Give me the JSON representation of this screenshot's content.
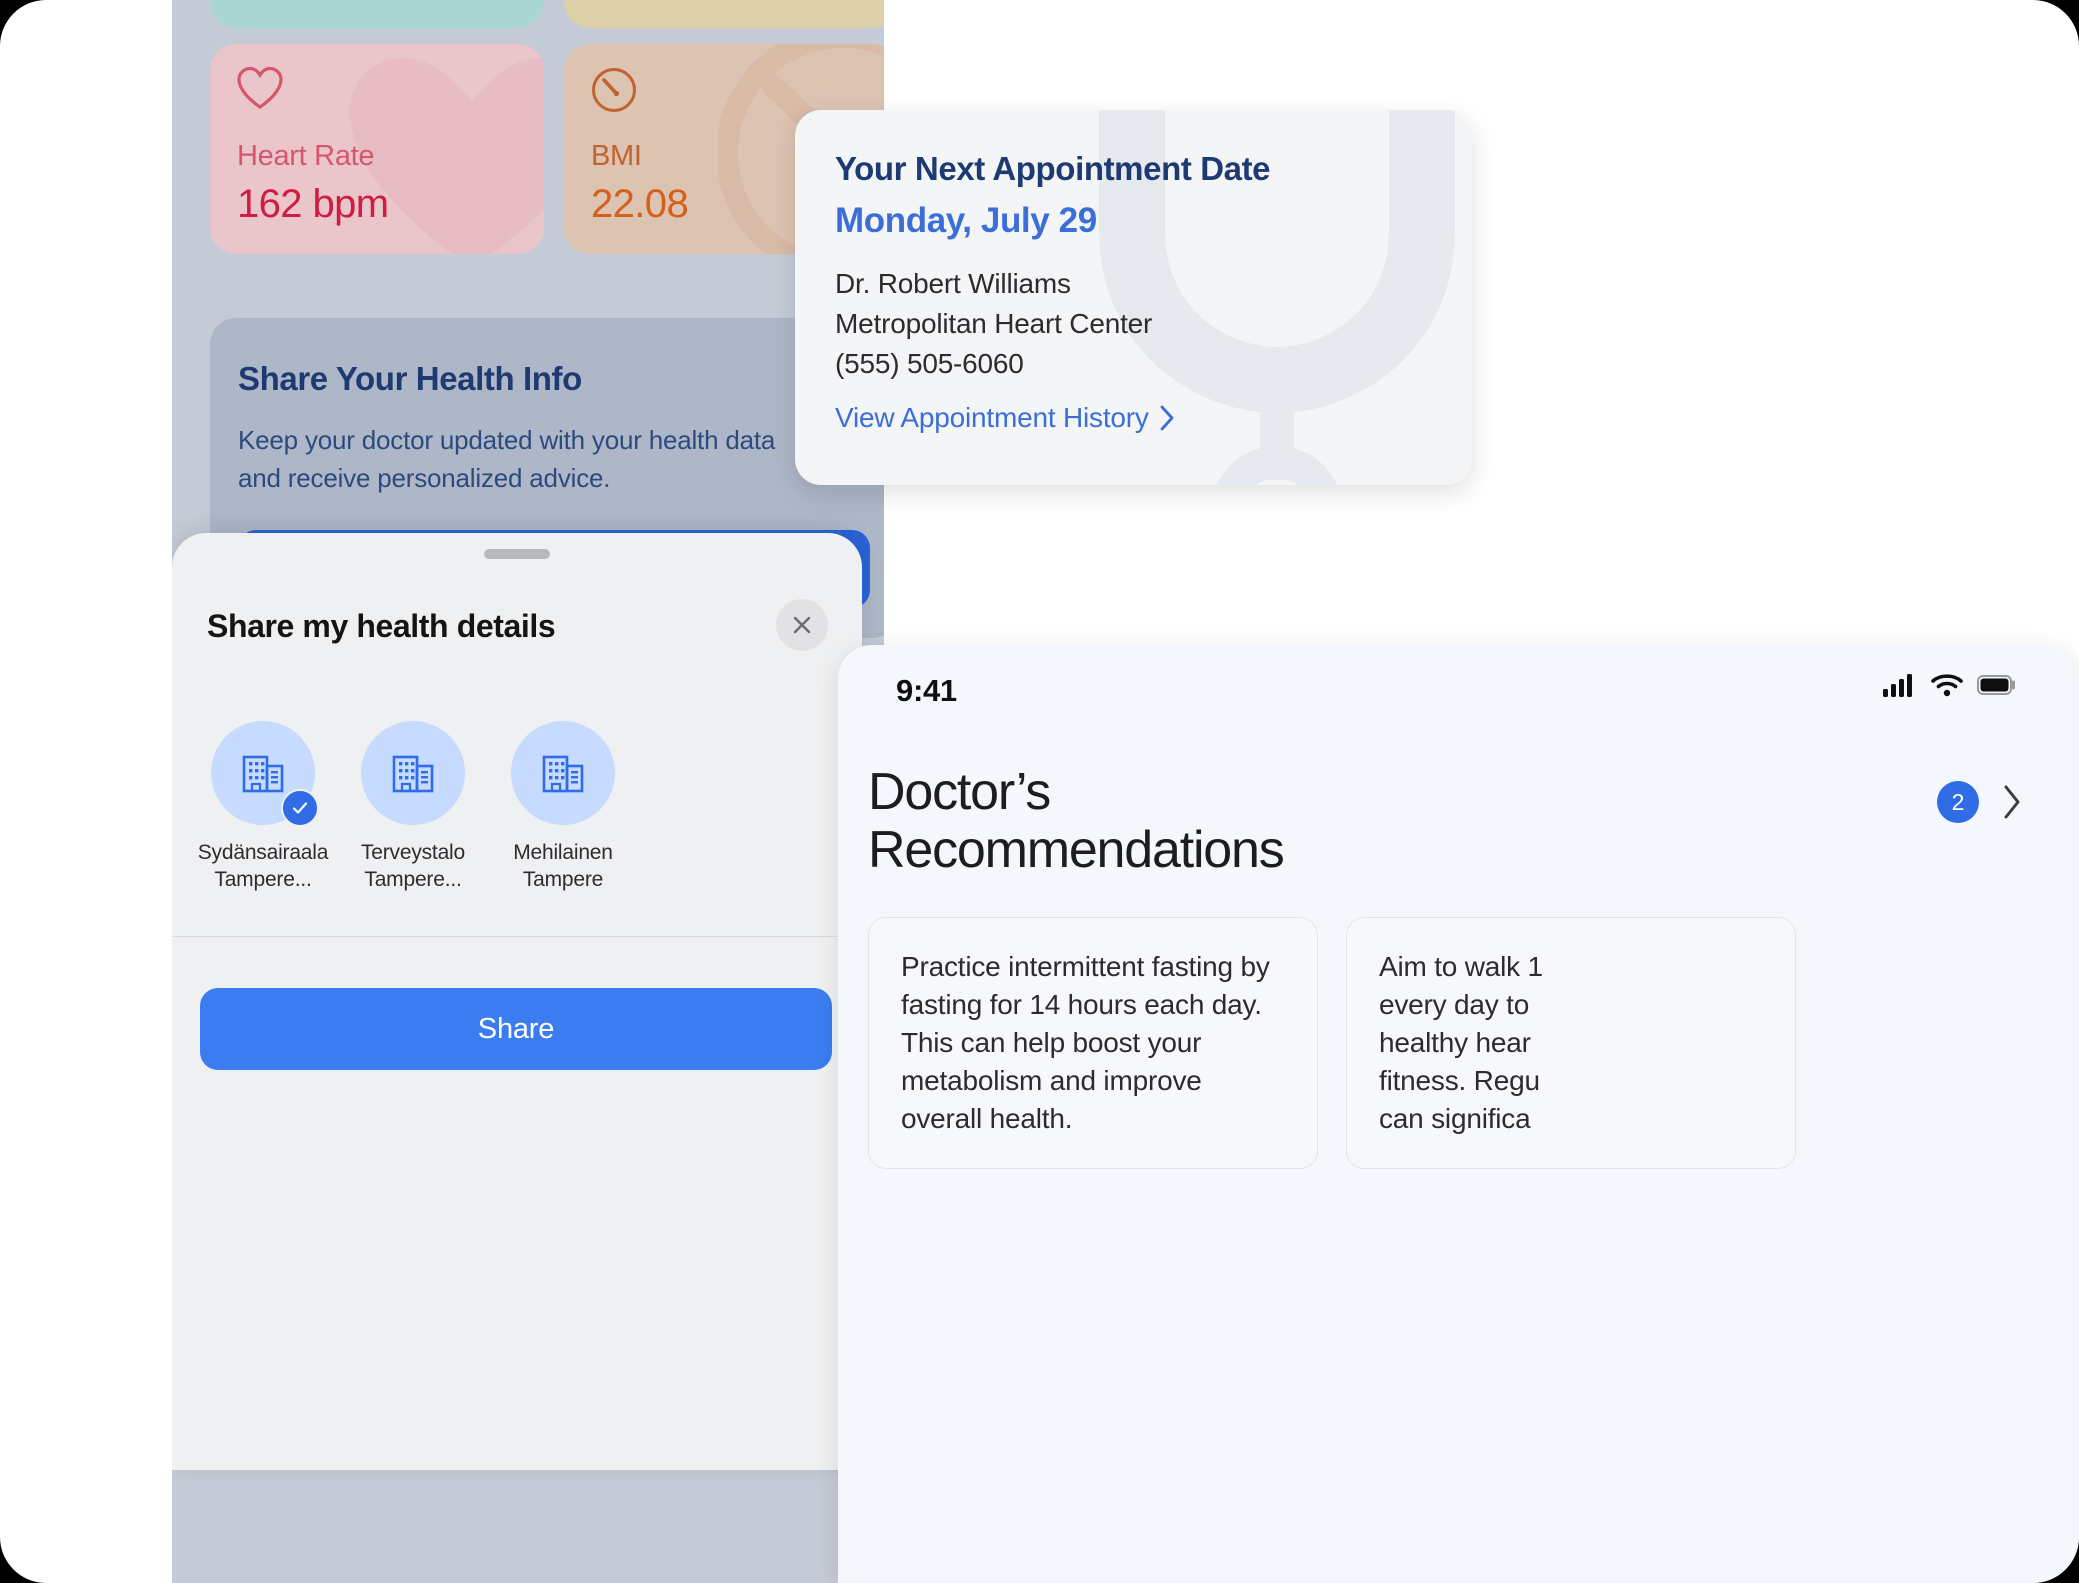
{
  "left_screen": {
    "metrics": [
      {
        "icon": "heart-icon",
        "label": "Heart Rate",
        "value": "162 bpm"
      },
      {
        "icon": "gauge-icon",
        "label": "BMI",
        "value": "22.08"
      }
    ],
    "share_info": {
      "title": "Share Your Health Info",
      "description": "Keep your doctor updated with your health data and receive personalized advice."
    }
  },
  "share_sheet": {
    "title": "Share my health details",
    "close_icon": "close-icon",
    "providers": [
      {
        "name": "Sydänsairaala\nTampere...",
        "icon": "hospital-building-icon",
        "selected": true
      },
      {
        "name": "Terveystalo\nTampere...",
        "icon": "hospital-building-icon",
        "selected": false
      },
      {
        "name": "Mehilainen\nTampere",
        "icon": "hospital-building-icon",
        "selected": false
      }
    ],
    "submit_label": "Share"
  },
  "appointment_card": {
    "heading": "Your Next Appointment Date",
    "date": "Monday, July 29",
    "doctor": "Dr. Robert Williams",
    "clinic": "Metropolitan Heart Center",
    "phone": "(555) 505-6060",
    "history_link": "View Appointment History",
    "history_chevron": "chevron-right-icon",
    "watermark_icon": "stethoscope-icon"
  },
  "recommendations_phone": {
    "status_bar": {
      "time": "9:41",
      "icons": [
        "cellular-signal-icon",
        "wifi-icon",
        "battery-icon"
      ]
    },
    "title": "Doctor’s Recommendations",
    "badge_count": "2",
    "chevron_icon": "chevron-right-icon",
    "cards": [
      "Practice intermittent fasting by fasting for 14 hours each day. This can help boost your metabolism and improve overall health.",
      "Aim to walk 1\nevery day to\nhealthy hear\nfitness. Regu\ncan significa"
    ]
  },
  "colors": {
    "accent_blue": "#3b7cf0",
    "link_blue": "#3b6ed8",
    "heading_navy": "#1e3a72",
    "heart_red": "#cf1c42",
    "bmi_orange": "#d4601b"
  }
}
